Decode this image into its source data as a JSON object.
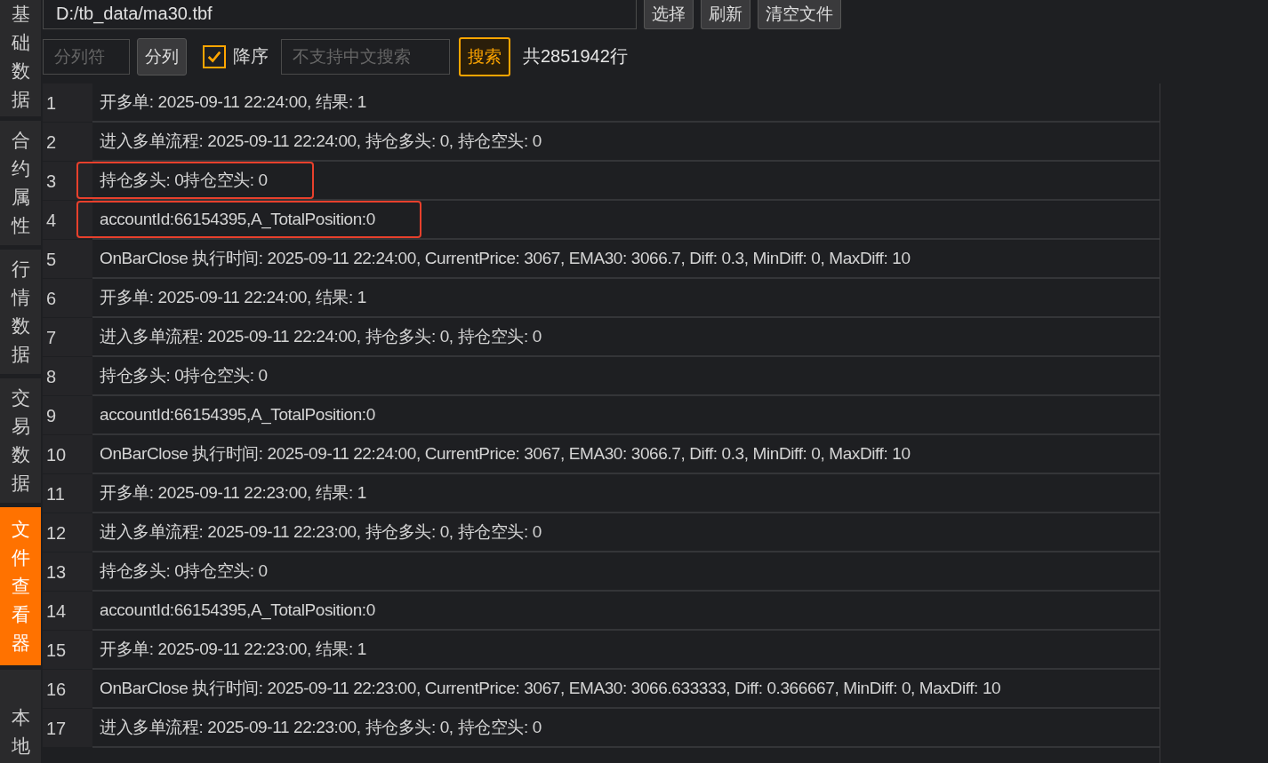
{
  "sidebar": {
    "tabs": [
      {
        "label": "基础数据",
        "selected": false
      },
      {
        "label": "合约属性",
        "selected": false
      },
      {
        "label": "行情数据",
        "selected": false
      },
      {
        "label": "交易数据",
        "selected": false
      },
      {
        "label": "文件查看器",
        "selected": true
      },
      {
        "label": "本地",
        "selected": false
      }
    ]
  },
  "toolbar": {
    "file_path": "D:/tb_data/ma30.tbf",
    "buttons": [
      "选择",
      "刷新",
      "清空文件"
    ],
    "separator_field": {
      "placeholder": "分列符"
    },
    "split_button": "分列",
    "descending": {
      "label": "降序",
      "checked": true
    },
    "search_field": {
      "placeholder": "不支持中文搜索"
    },
    "search_button": "搜索",
    "row_count": "共2851942行"
  },
  "table": {
    "rows": [
      {
        "number": "1",
        "text": "开多单: 2025-09-11 22:24:00, 结果: 1",
        "highlighted": false
      },
      {
        "number": "2",
        "text": "进入多单流程: 2025-09-11 22:24:00, 持仓多头: 0, 持仓空头: 0",
        "highlighted": false
      },
      {
        "number": "3",
        "text": "持仓多头: 0持仓空头: 0",
        "highlighted": true
      },
      {
        "number": "4",
        "text": "accountId:66154395,A_TotalPosition:0",
        "highlighted": true
      },
      {
        "number": "5",
        "text": "OnBarClose 执行时间: 2025-09-11 22:24:00, CurrentPrice: 3067, EMA30: 3066.7, Diff: 0.3, MinDiff: 0, MaxDiff: 10",
        "highlighted": false
      },
      {
        "number": "6",
        "text": "开多单: 2025-09-11 22:24:00, 结果: 1",
        "highlighted": false
      },
      {
        "number": "7",
        "text": "进入多单流程: 2025-09-11 22:24:00, 持仓多头: 0, 持仓空头: 0",
        "highlighted": false
      },
      {
        "number": "8",
        "text": "持仓多头: 0持仓空头: 0",
        "highlighted": false
      },
      {
        "number": "9",
        "text": "accountId:66154395,A_TotalPosition:0",
        "highlighted": false
      },
      {
        "number": "10",
        "text": "OnBarClose 执行时间: 2025-09-11 22:24:00, CurrentPrice: 3067, EMA30: 3066.7, Diff: 0.3, MinDiff: 0, MaxDiff: 10",
        "highlighted": false
      },
      {
        "number": "11",
        "text": "开多单: 2025-09-11 22:23:00, 结果: 1",
        "highlighted": false
      },
      {
        "number": "12",
        "text": "进入多单流程: 2025-09-11 22:23:00, 持仓多头: 0, 持仓空头: 0",
        "highlighted": false
      },
      {
        "number": "13",
        "text": "持仓多头: 0持仓空头: 0",
        "highlighted": false
      },
      {
        "number": "14",
        "text": "accountId:66154395,A_TotalPosition:0",
        "highlighted": false
      },
      {
        "number": "15",
        "text": "开多单: 2025-09-11 22:23:00, 结果: 1",
        "highlighted": false
      },
      {
        "number": "16",
        "text": "OnBarClose 执行时间: 2025-09-11 22:23:00, CurrentPrice: 3067, EMA30: 3066.633333, Diff: 0.366667, MinDiff: 0, MaxDiff: 10",
        "highlighted": false
      },
      {
        "number": "17",
        "text": "进入多单流程: 2025-09-11 22:23:00, 持仓多头: 0, 持仓空头: 0",
        "highlighted": false
      }
    ]
  }
}
